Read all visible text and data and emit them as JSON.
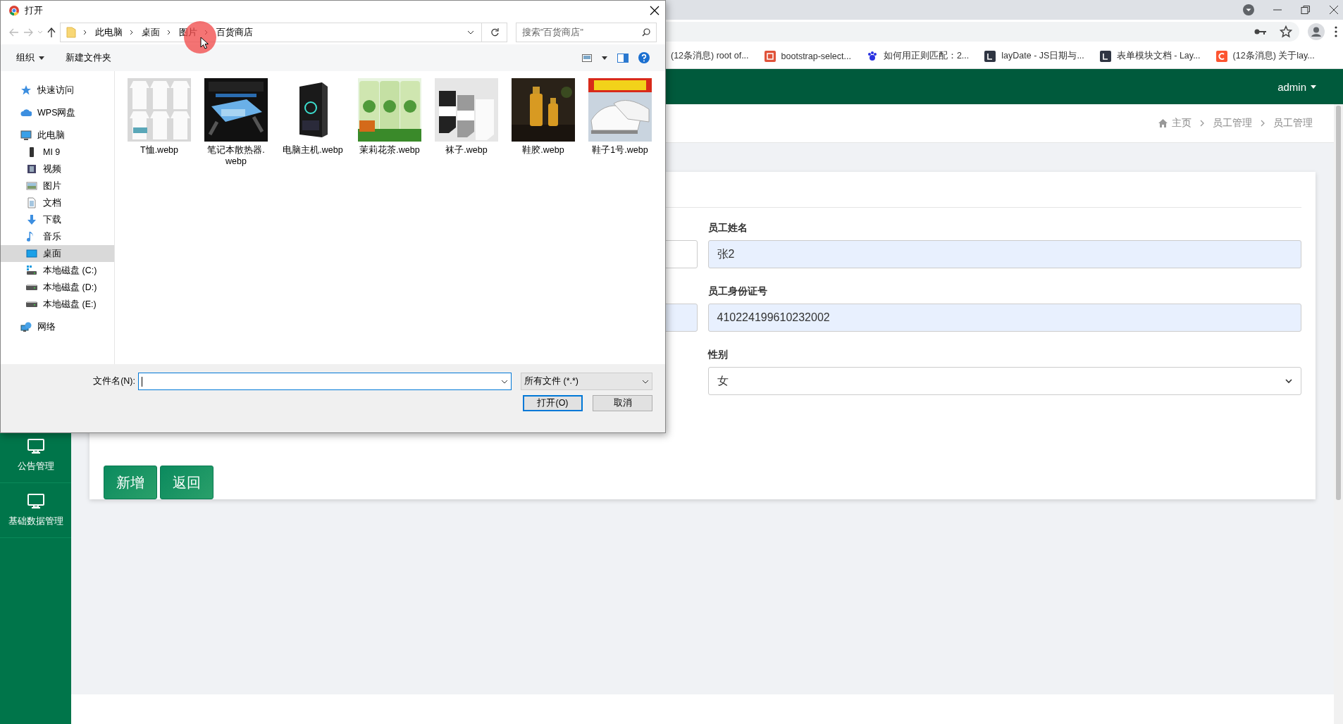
{
  "browser": {
    "bookmarks": [
      {
        "title": "(12条消息) root of..."
      },
      {
        "title": "bootstrap-select...",
        "kind": "jian"
      },
      {
        "title": "如何用正则匹配：2...",
        "kind": "paw"
      },
      {
        "title": "layDate - JS日期与...",
        "kind": "lay"
      },
      {
        "title": "表单模块文档 - Lay...",
        "kind": "lay"
      },
      {
        "title": "(12条消息) 关于lay...",
        "kind": "c"
      }
    ]
  },
  "app": {
    "user": "admin",
    "breadcrumb": [
      "主页",
      "员工管理",
      "员工管理"
    ],
    "sidebar": [
      {
        "label": "公告管理"
      },
      {
        "label": "基础数据管理"
      }
    ],
    "left_fields": [
      {
        "autofilled": false
      },
      {
        "autofilled": true
      }
    ],
    "fields": [
      {
        "label": "员工姓名",
        "value": "张2",
        "kind": "input",
        "autofilled": true
      },
      {
        "label": "员工身份证号",
        "value": "410224199610232002",
        "kind": "input",
        "autofilled": true
      },
      {
        "label": "性别",
        "value": "女",
        "kind": "select",
        "autofilled": false
      }
    ],
    "buttons": [
      "新增",
      "返回"
    ]
  },
  "dialog": {
    "title": "打开",
    "path": [
      "此电脑",
      "桌面",
      "图片",
      "百货商店"
    ],
    "search": {
      "placeholder": "搜索\"百货商店\""
    },
    "toolbar": [
      "组织",
      "新建文件夹"
    ],
    "nav": [
      {
        "label": "快速访问",
        "kind": "star",
        "selected": false
      },
      {
        "label": "WPS网盘",
        "kind": "cloud",
        "selected": false
      },
      {
        "label": "此电脑",
        "kind": "pc",
        "selected": false,
        "children": [
          {
            "label": "MI 9",
            "kind": "phone",
            "selected": false
          },
          {
            "label": "视频",
            "kind": "video",
            "selected": false
          },
          {
            "label": "图片",
            "kind": "pictures",
            "selected": false
          },
          {
            "label": "文档",
            "kind": "docs",
            "selected": false
          },
          {
            "label": "下载",
            "kind": "download",
            "selected": false
          },
          {
            "label": "音乐",
            "kind": "music",
            "selected": false
          },
          {
            "label": "桌面",
            "kind": "desktop",
            "selected": true
          },
          {
            "label": "本地磁盘 (C:)",
            "kind": "drivewin",
            "selected": false
          },
          {
            "label": "本地磁盘 (D:)",
            "kind": "drive",
            "selected": false
          },
          {
            "label": "本地磁盘 (E:)",
            "kind": "drive",
            "selected": false
          }
        ]
      },
      {
        "label": "网络",
        "kind": "network",
        "selected": false
      }
    ],
    "files": [
      {
        "name": "T恤.webp",
        "kind": "picture"
      },
      {
        "name": "笔记本散热器.webp",
        "kind": "picture"
      },
      {
        "name": "电脑主机.webp",
        "kind": "picture"
      },
      {
        "name": "茉莉花茶.webp",
        "kind": "picture"
      },
      {
        "name": "袜子.webp",
        "kind": "picture"
      },
      {
        "name": "鞋胶.webp",
        "kind": "picture"
      },
      {
        "name": "鞋子1号.webp",
        "kind": "picture"
      }
    ],
    "filename_label": "文件名(N):",
    "filetype": "所有文件 (*.*)",
    "buttons": [
      {
        "label": "打开(O)",
        "kind": "primary"
      },
      {
        "label": "取消",
        "kind": "normal"
      }
    ]
  }
}
